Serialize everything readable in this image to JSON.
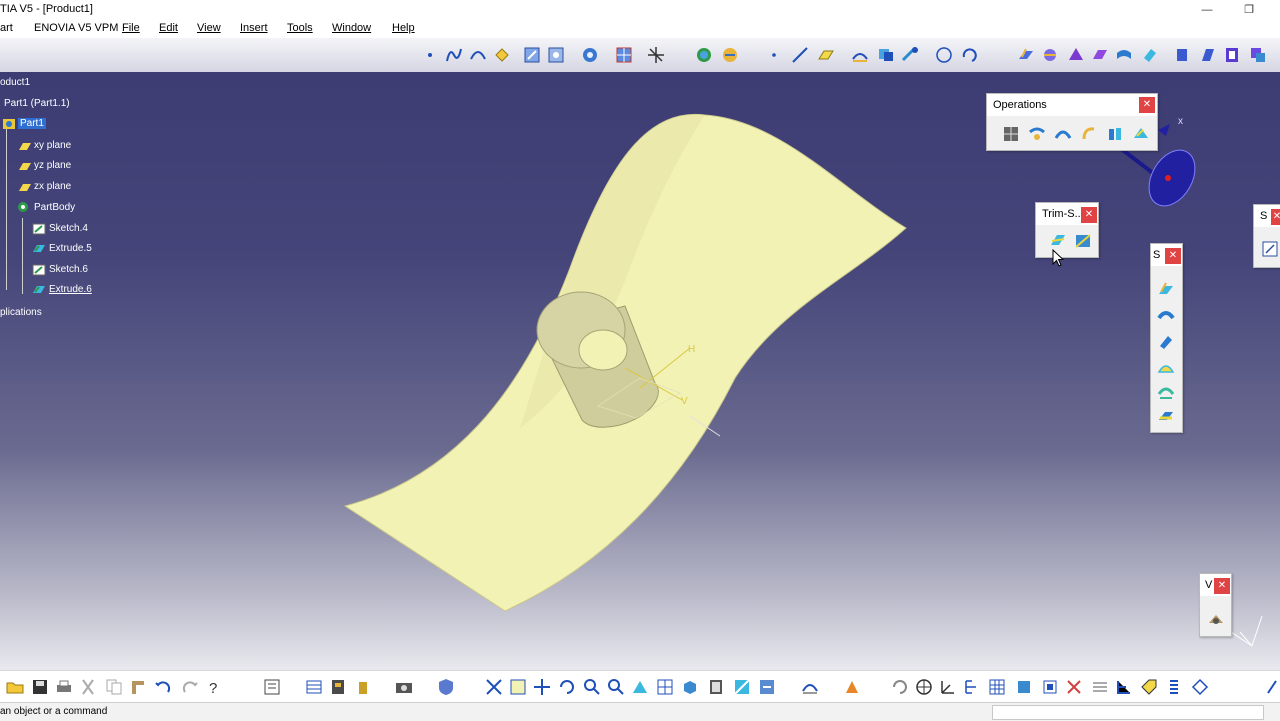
{
  "window": {
    "title": "TIA V5 - [Product1]"
  },
  "menu": {
    "items": [
      {
        "label": "art",
        "u": false
      },
      {
        "label": "ENOVIA V5 VPM",
        "u": false
      },
      {
        "label": "File",
        "u": true
      },
      {
        "label": "Edit",
        "u": true
      },
      {
        "label": "View",
        "u": true
      },
      {
        "label": "Insert",
        "u": true
      },
      {
        "label": "Tools",
        "u": true
      },
      {
        "label": "Window",
        "u": true
      },
      {
        "label": "Help",
        "u": true
      }
    ]
  },
  "tree": {
    "root": "oduct1",
    "part_instance": "Part1 (Part1.1)",
    "part": "Part1",
    "planes": [
      "xy plane",
      "yz plane",
      "zx plane"
    ],
    "body": "PartBody",
    "features": [
      "Sketch.4",
      "Extrude.5",
      "Sketch.6",
      "Extrude.6"
    ],
    "applications": "plications"
  },
  "toolbars": {
    "operations": {
      "title": "Operations"
    },
    "trim": {
      "title": "Trim-S..."
    },
    "surfaces": {
      "title": "S"
    },
    "right_edge": {
      "title": "S"
    },
    "view": {
      "title": "V"
    }
  },
  "axis": {
    "x_label": "x"
  },
  "sketch": {
    "h_label": "H",
    "v_label": "V"
  },
  "status": {
    "message": "an object or a command"
  },
  "colors": {
    "background_top": "#3b3b72",
    "surface": "#f3f2b5",
    "selection": "#2f6fd3",
    "close": "#e04343"
  }
}
